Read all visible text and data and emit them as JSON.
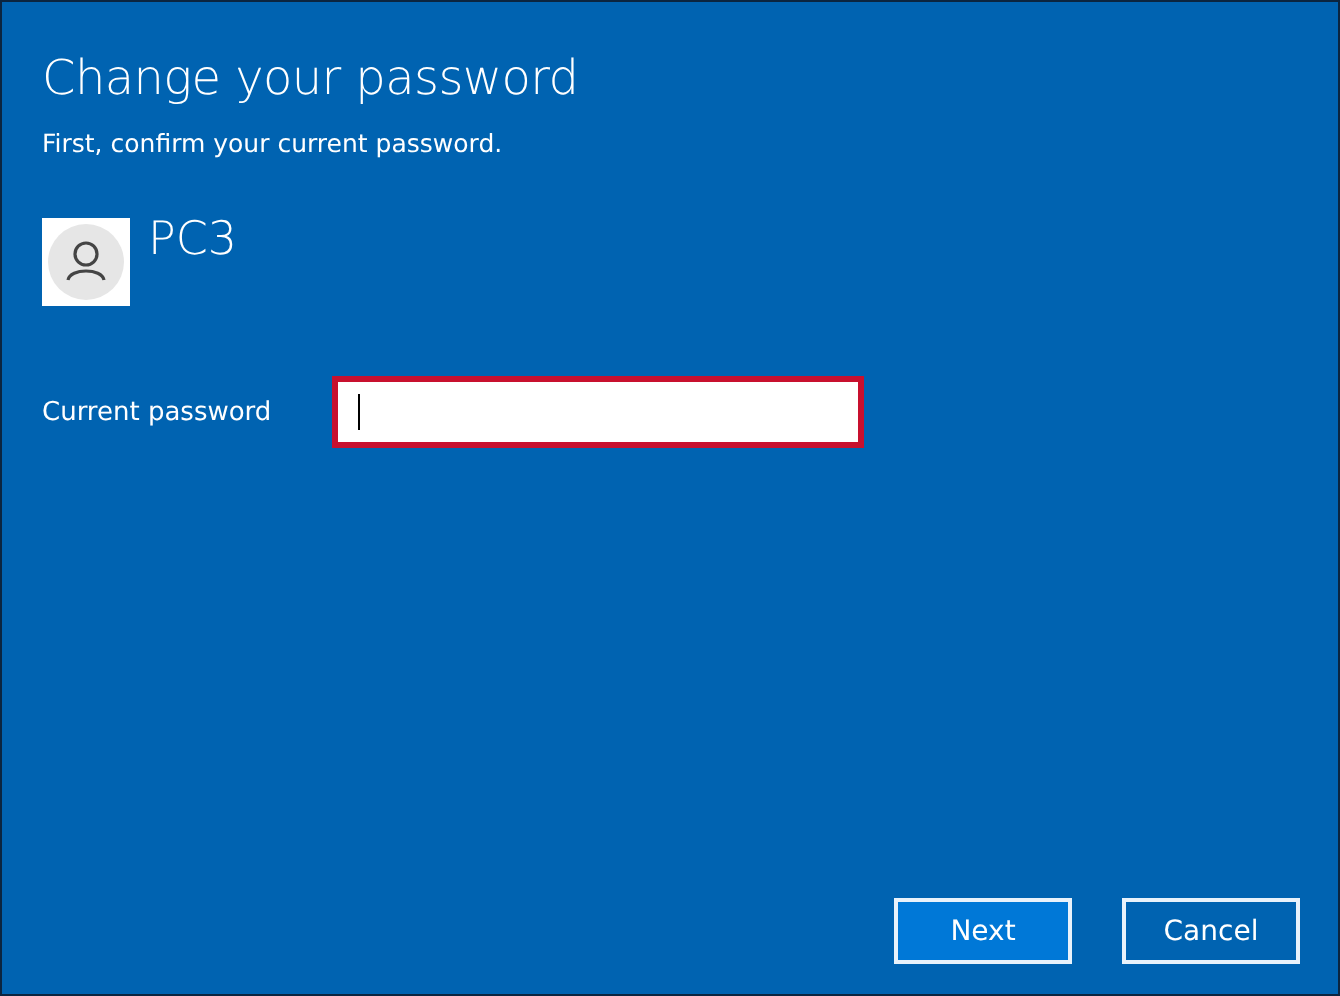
{
  "window": {
    "title": "Change your password",
    "subtitle": "First, confirm your current password."
  },
  "account": {
    "name": "PC3"
  },
  "fields": [
    {
      "label": "Current password",
      "focused": true,
      "highlighted": true
    }
  ],
  "buttons": [
    {
      "label": "Next",
      "default": true
    },
    {
      "label": "Cancel",
      "default": false
    }
  ]
}
